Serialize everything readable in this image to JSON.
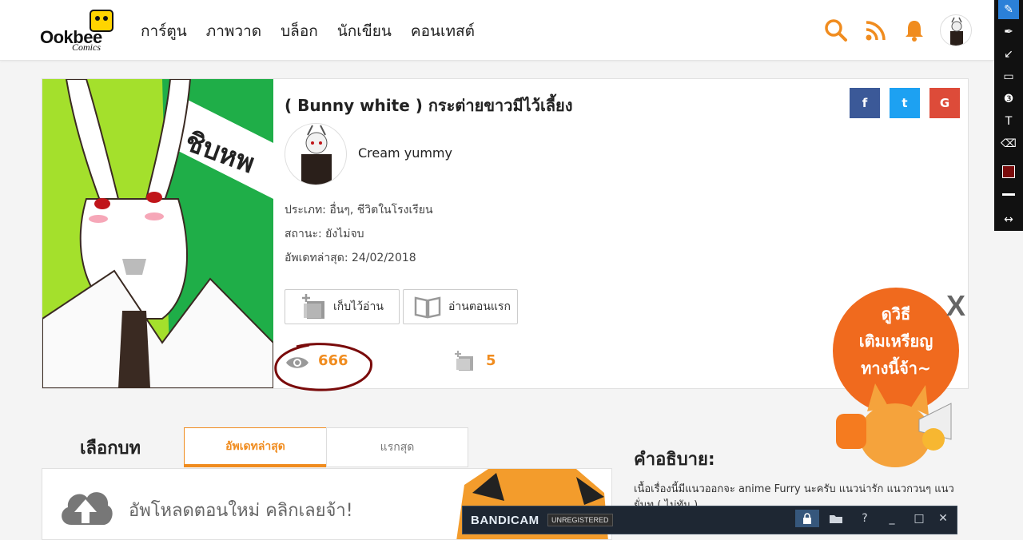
{
  "nav": {
    "logo_main": "Ookbee",
    "logo_sub": "Comics",
    "items": [
      "การ์ตูน",
      "ภาพวาด",
      "บล็อก",
      "นักเขียน",
      "คอนเทสต์"
    ]
  },
  "icons": {
    "search": "search-icon",
    "rss": "rss-icon",
    "bell": "bell-icon"
  },
  "colors": {
    "accent": "#f08c1f",
    "facebook": "#3b5998",
    "twitter": "#1da1f2",
    "google": "#dd4b39",
    "annotation": "#7a0b0b"
  },
  "book": {
    "title": "( Bunny white ) กระต่ายขาวมีไว้เลี้ยง",
    "author": "Cream yummy",
    "category": "ประเภท: อื่นๆ, ชีวิตในโรงเรียน",
    "status": "สถานะ: ยังไม่จบ",
    "updated": "อัพเดทล่าสุด: 24/02/2018",
    "cover_text": "ชิบหพ",
    "bookmark_label": "เก็บไว้อ่าน",
    "read_first_label": "อ่านตอนแรก",
    "views": "666",
    "bookmarks": "5"
  },
  "social": {
    "facebook": "f",
    "twitter": "t",
    "google": "G"
  },
  "chapters": {
    "title": "เลือกบท",
    "tab_latest": "อัพเดทล่าสุด",
    "tab_first": "แรกสุด",
    "upload_text": "อัพโหลดตอนใหม่ คลิกเลยจ้า!"
  },
  "description": {
    "title": "คำอธิบาย:",
    "text": "เนื้อเรื่องนี้มีแนวออกจะ anime Furry นะครับ แนวน่ารัก แนวกวนๆ แนว ยั่นท ( ไม่ทัน )"
  },
  "promo": {
    "line1": "ดูวิธี",
    "line2": "เติมเหรียญ",
    "line3": "ทางนี้จ้า~",
    "close": "X"
  },
  "bandicam": {
    "name": "BANDICAM",
    "unregistered": "UNREGISTERED",
    "help": "?",
    "min": "_",
    "max": "□",
    "close": "✕"
  }
}
